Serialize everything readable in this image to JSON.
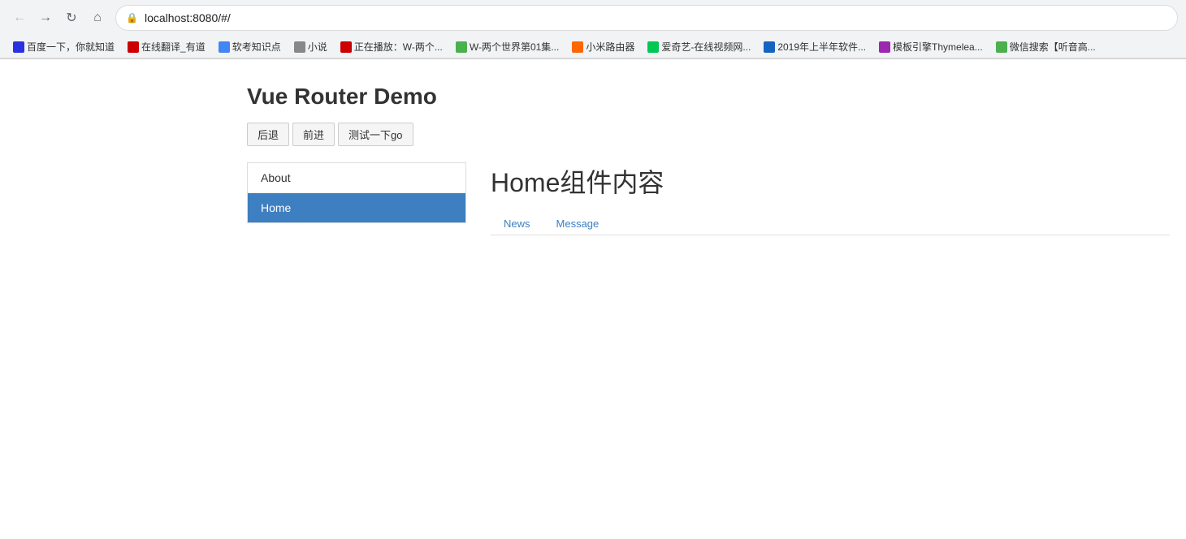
{
  "browser": {
    "url": "localhost:8080/#/",
    "bookmarks": [
      {
        "label": "百度一下，你就知道",
        "color": "#2932e1"
      },
      {
        "label": "在线翻译_有道",
        "color": "#c00"
      },
      {
        "label": "软考知识点",
        "color": "#4285f4"
      },
      {
        "label": "小说",
        "color": "#888"
      },
      {
        "label": "正在播放：W-两个...",
        "color": "#c00"
      },
      {
        "label": "W-两个世界第01集...",
        "color": "#4caf50"
      },
      {
        "label": "小米路由器",
        "color": "#ff6600"
      },
      {
        "label": "爱奇艺-在线视频网...",
        "color": "#00c853"
      },
      {
        "label": "2019年上半年软件...",
        "color": "#1565c0"
      },
      {
        "label": "模板引擎Thymelea...",
        "color": "#9c27b0"
      },
      {
        "label": "微信搜索【听音高...",
        "color": "#4caf50"
      }
    ]
  },
  "app": {
    "title": "Vue Router Demo",
    "buttons": {
      "back": "后退",
      "forward": "前进",
      "test": "测试一下go"
    }
  },
  "sidebar": {
    "items": [
      {
        "label": "About",
        "active": false
      },
      {
        "label": "Home",
        "active": true
      }
    ]
  },
  "content": {
    "title": "Home组件内容",
    "sub_nav": [
      {
        "label": "News"
      },
      {
        "label": "Message"
      }
    ]
  }
}
